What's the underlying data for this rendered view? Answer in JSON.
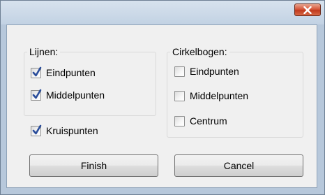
{
  "dialog": {
    "title": "",
    "close_icon": "close-icon"
  },
  "lijnen": {
    "title": "Lijnen:",
    "items": [
      {
        "label": "Eindpunten",
        "checked": true
      },
      {
        "label": "Middelpunten",
        "checked": true
      }
    ]
  },
  "cirkelbogen": {
    "title": "Cirkelbogen:",
    "items": [
      {
        "label": "Eindpunten",
        "checked": false
      },
      {
        "label": "Middelpunten",
        "checked": false
      },
      {
        "label": "Centrum",
        "checked": false
      }
    ]
  },
  "kruispunten": {
    "label": "Kruispunten",
    "checked": true
  },
  "buttons": {
    "finish": "Finish",
    "cancel": "Cancel"
  },
  "colors": {
    "check_mark": "#2a4d9b",
    "close_button": "#c9462a"
  }
}
